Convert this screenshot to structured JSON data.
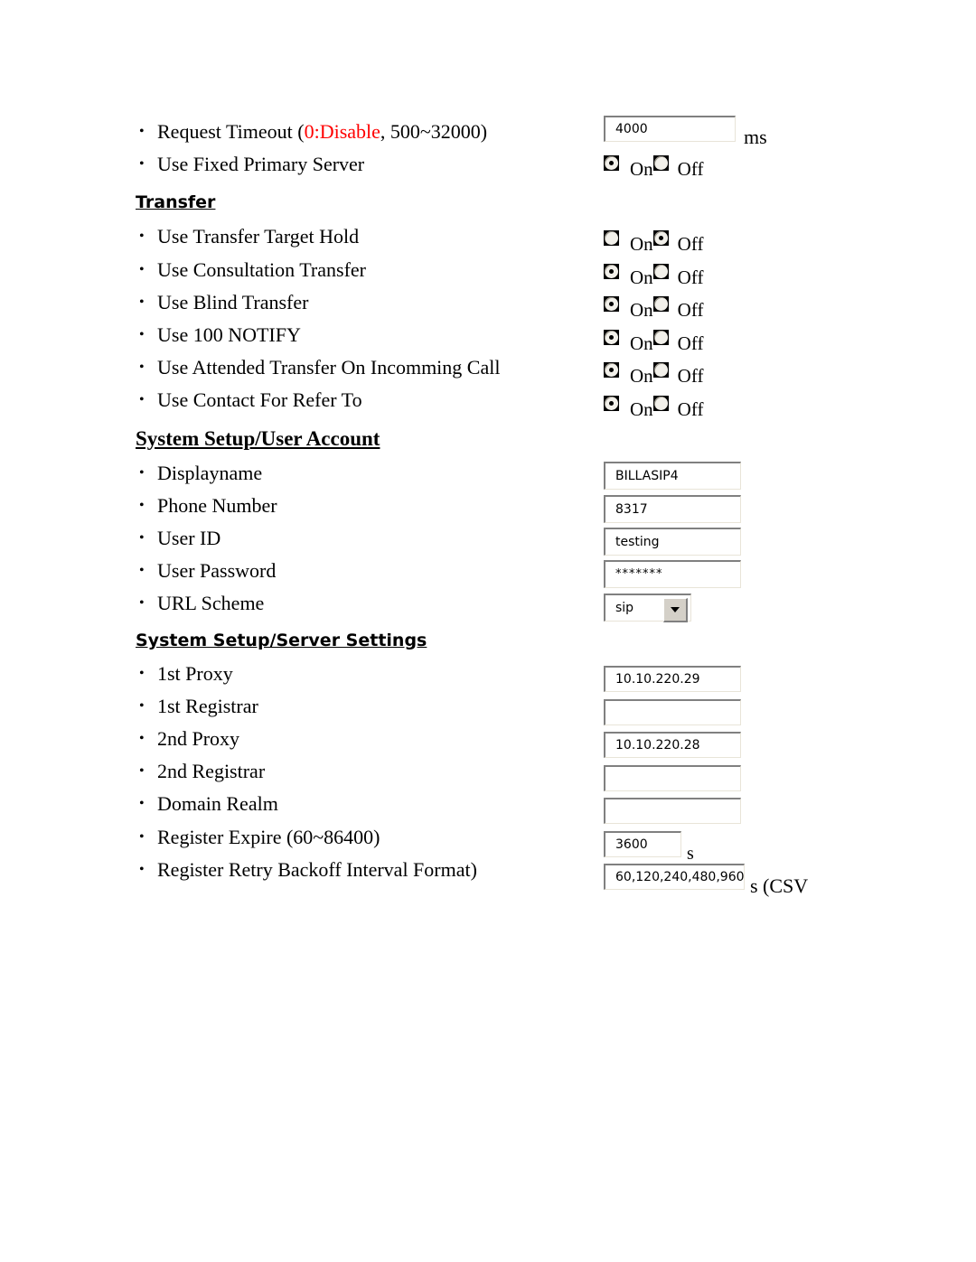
{
  "document": {
    "sections": [
      {
        "id": "sip-timers",
        "heading": null,
        "items": [
          {
            "label_prefix": "Request Timeout (",
            "label_red": "0:Disable",
            "label_suffix": ", 500~32000)",
            "control": "text",
            "value": "4000",
            "unit": "ms"
          },
          {
            "label": "Use Fixed Primary Server",
            "control": "radio",
            "selected": "On"
          }
        ]
      },
      {
        "id": "transfer",
        "heading": "Transfer",
        "heading_style": "sans",
        "items": [
          {
            "label": "Use Transfer Target Hold",
            "control": "radio",
            "selected": "Off"
          },
          {
            "label": "Use Consultation Transfer",
            "control": "radio",
            "selected": "On"
          },
          {
            "label": "Use Blind Transfer",
            "control": "radio",
            "selected": "On"
          },
          {
            "label": "Use 100 NOTIFY",
            "control": "radio",
            "selected": "On"
          },
          {
            "label": "Use Attended Transfer On Incomming Call",
            "control": "radio",
            "selected": "On"
          },
          {
            "label": "Use Contact For Refer To",
            "control": "radio",
            "selected": "On"
          }
        ]
      },
      {
        "id": "user-account",
        "heading": "System Setup/User Account",
        "heading_style": "serif",
        "items": [
          {
            "label": "Displayname",
            "control": "text",
            "value": "BILLASIP4"
          },
          {
            "label": "Phone Number",
            "control": "text",
            "value": "8317"
          },
          {
            "label": "User ID",
            "control": "text",
            "value": "testing"
          },
          {
            "label": "User Password",
            "control": "password",
            "value": "*******"
          },
          {
            "label": "URL Scheme",
            "control": "select",
            "value": "sip"
          }
        ]
      },
      {
        "id": "server-settings",
        "heading": "System Setup/Server Settings",
        "heading_style": "sans",
        "items": [
          {
            "label": "1st Proxy",
            "control": "text",
            "value": "10.10.220.29"
          },
          {
            "label": "1st Registrar",
            "control": "text",
            "value": ""
          },
          {
            "label": "2nd Proxy",
            "control": "text",
            "value": "10.10.220.28"
          },
          {
            "label": "2nd Registrar",
            "control": "text",
            "value": ""
          },
          {
            "label": "Domain Realm",
            "control": "text",
            "value": ""
          },
          {
            "label": "Register Expire (60~86400)",
            "control": "text",
            "value": "3600",
            "unit": "s"
          },
          {
            "label": "Register Retry Backoff Interval Format)",
            "control": "text",
            "value": "60,120,240,480,960",
            "unit": "s (CSV"
          }
        ]
      }
    ]
  },
  "labels": {
    "radio_on": "On",
    "radio_off": "Off"
  },
  "text": {
    "request_timeout_prefix": "Request Timeout (",
    "request_timeout_red": "0:Disable",
    "request_timeout_suffix": ", 500~32000)",
    "use_fixed_primary_server": "Use Fixed Primary Server",
    "transfer_heading": "Transfer",
    "use_transfer_target_hold": "Use Transfer Target Hold",
    "use_consultation_transfer": "Use Consultation Transfer",
    "use_blind_transfer": "Use Blind Transfer",
    "use_100_notify": "Use 100 NOTIFY",
    "use_attended_transfer": "Use Attended Transfer On Incomming Call",
    "use_contact_for_refer_to": "Use Contact For Refer To",
    "user_account_heading": "System Setup/User Account",
    "displayname": "Displayname",
    "phone_number": "Phone Number",
    "user_id": "User ID",
    "user_password": "User Password",
    "url_scheme": "URL Scheme",
    "server_settings_heading": "System Setup/Server Settings",
    "proxy_1st": "1st Proxy",
    "registrar_1st": "1st Registrar",
    "proxy_2nd": "2nd Proxy",
    "registrar_2nd": "2nd Registrar",
    "domain_realm": "Domain Realm",
    "register_expire": "Register Expire (60~86400)",
    "register_retry": "Register Retry Backoff Interval Format)"
  },
  "values": {
    "request_timeout": "4000",
    "displayname": "BILLASIP4",
    "phone_number": "8317",
    "user_id": "testing",
    "user_password": "*******",
    "url_scheme": "sip",
    "proxy_1st": "10.10.220.29",
    "registrar_1st": "",
    "proxy_2nd": "10.10.220.28",
    "registrar_2nd": "",
    "domain_realm": "",
    "register_expire": "3600",
    "register_retry": "60,120,240,480,960"
  },
  "units": {
    "ms": "ms",
    "s": "s",
    "s_csv": "s (CSV"
  },
  "colors": {
    "red_accent": "#ff0000",
    "field_border_dark": "#808080",
    "field_border_light": "#e8e4d8",
    "button_face": "#d4d0c8",
    "page_bg": "#ffffff"
  }
}
